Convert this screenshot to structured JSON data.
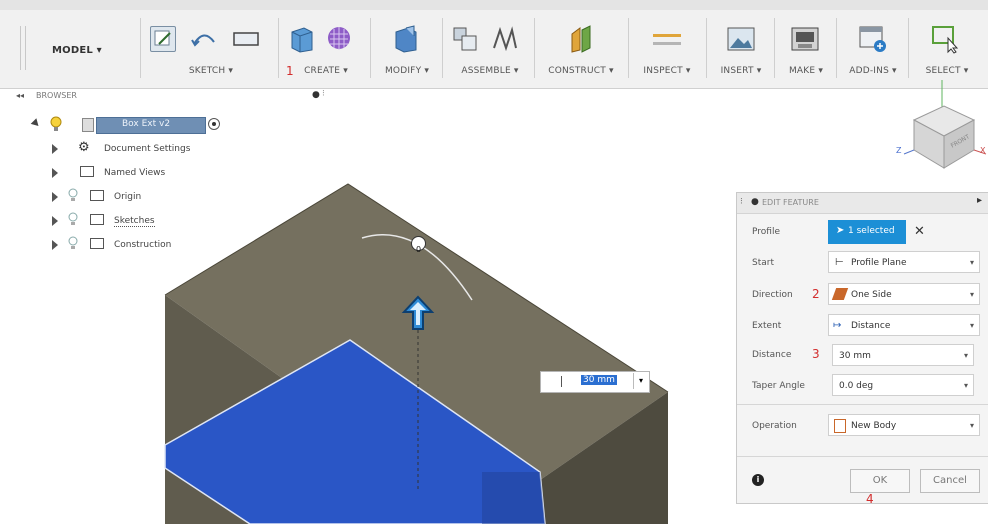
{
  "toolbar": {
    "model_label": "MODEL ▾",
    "groups": [
      {
        "label": "SKETCH ▾"
      },
      {
        "label": "CREATE ▾",
        "step": "1"
      },
      {
        "label": "MODIFY ▾"
      },
      {
        "label": "ASSEMBLE ▾"
      },
      {
        "label": "CONSTRUCT ▾"
      },
      {
        "label": "INSPECT ▾"
      },
      {
        "label": "INSERT ▾"
      },
      {
        "label": "MAKE ▾"
      },
      {
        "label": "ADD-INS ▾"
      },
      {
        "label": "SELECT ▾"
      }
    ]
  },
  "browser": {
    "title": "BROWSER",
    "root_label": "Box Ext v2",
    "items": [
      {
        "label": "Document Settings",
        "icon": "gear-icon"
      },
      {
        "label": "Named Views",
        "icon": "folder-icon"
      },
      {
        "label": "Origin",
        "icon": "folder-icon"
      },
      {
        "label": "Sketches",
        "icon": "folder-icon"
      },
      {
        "label": "Construction",
        "icon": "folder-icon"
      }
    ]
  },
  "viewcube": {
    "axis_x": "X",
    "axis_z": "Z",
    "face": "FRONT"
  },
  "canvas": {
    "distance_input": "30 mm",
    "manipulator_value": "0",
    "colors": {
      "body_top": "#75705f",
      "body_side": "#5a5749",
      "profile": "#2a56c6"
    }
  },
  "panel": {
    "title": "EDIT FEATURE",
    "rows": {
      "profile": {
        "label": "Profile",
        "value": "1 selected"
      },
      "start": {
        "label": "Start",
        "value": "Profile Plane"
      },
      "direction": {
        "label": "Direction",
        "value": "One Side",
        "step": "2"
      },
      "extent": {
        "label": "Extent",
        "value": "Distance"
      },
      "distance": {
        "label": "Distance",
        "value": "30 mm",
        "step": "3"
      },
      "taper": {
        "label": "Taper Angle",
        "value": "0.0 deg"
      },
      "operation": {
        "label": "Operation",
        "value": "New Body"
      }
    },
    "ok_label": "OK",
    "cancel_label": "Cancel",
    "ok_step": "4",
    "accent": "#1c8fd6"
  }
}
